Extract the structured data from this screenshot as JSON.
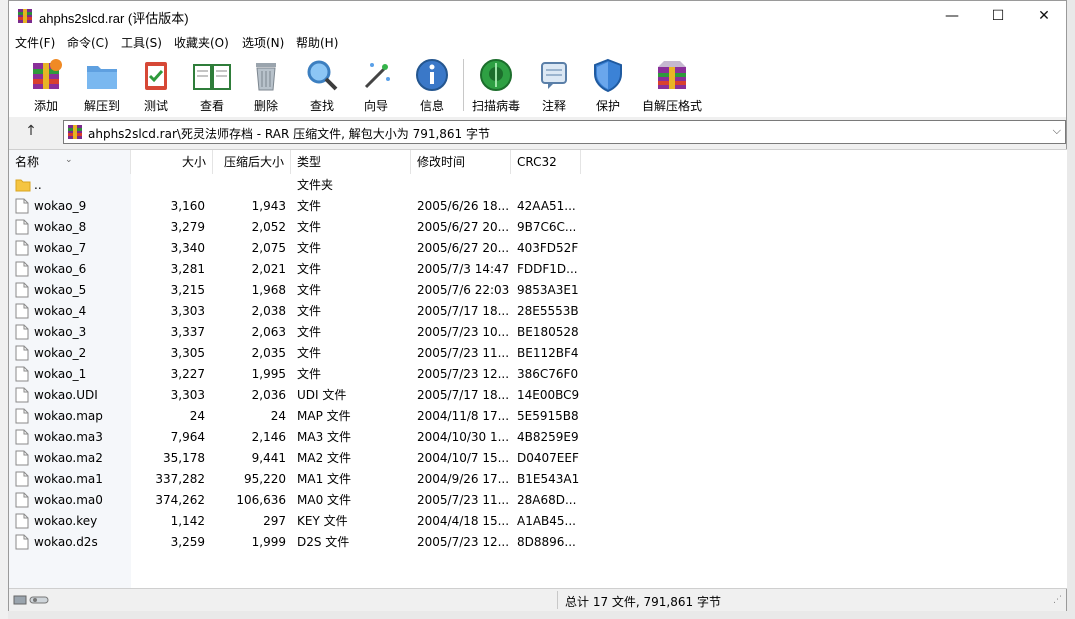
{
  "window": {
    "title": "ahphs2slcd.rar (评估版本)",
    "minimize": "—",
    "maximize": "☐",
    "close": "✕"
  },
  "menu": [
    "文件(F)",
    "命令(C)",
    "工具(S)",
    "收藏夹(O)",
    "选项(N)",
    "帮助(H)"
  ],
  "toolbar": [
    {
      "label": "添加",
      "icon": "add-archive-icon"
    },
    {
      "label": "解压到",
      "icon": "extract-folder-icon"
    },
    {
      "label": "测试",
      "icon": "test-clipboard-icon"
    },
    {
      "label": "查看",
      "icon": "view-book-icon"
    },
    {
      "label": "删除",
      "icon": "trash-icon"
    },
    {
      "label": "查找",
      "icon": "magnifier-icon"
    },
    {
      "label": "向导",
      "icon": "wizard-wand-icon"
    },
    {
      "label": "信息",
      "icon": "info-icon"
    },
    {
      "label": "扫描病毒",
      "icon": "virus-scan-icon"
    },
    {
      "label": "注释",
      "icon": "comment-icon"
    },
    {
      "label": "保护",
      "icon": "shield-icon"
    },
    {
      "label": "自解压格式",
      "icon": "sfx-box-icon"
    }
  ],
  "address": {
    "up": "↑",
    "path": "ahphs2slcd.rar\\死灵法师存档 - RAR 压缩文件, 解包大小为 791,861 字节",
    "dropdown": "⌵"
  },
  "columns": {
    "name": "名称",
    "size": "大小",
    "packed": "压缩后大小",
    "type": "类型",
    "modified": "修改时间",
    "crc": "CRC32"
  },
  "files": [
    {
      "name": "..",
      "size": "",
      "packed": "",
      "type": "文件夹",
      "modified": "",
      "crc": "",
      "folder": true
    },
    {
      "name": "wokao_9",
      "size": "3,160",
      "packed": "1,943",
      "type": "文件",
      "modified": "2005/6/26 18...",
      "crc": "42AA51..."
    },
    {
      "name": "wokao_8",
      "size": "3,279",
      "packed": "2,052",
      "type": "文件",
      "modified": "2005/6/27 20...",
      "crc": "9B7C6C..."
    },
    {
      "name": "wokao_7",
      "size": "3,340",
      "packed": "2,075",
      "type": "文件",
      "modified": "2005/6/27 20...",
      "crc": "403FD52F"
    },
    {
      "name": "wokao_6",
      "size": "3,281",
      "packed": "2,021",
      "type": "文件",
      "modified": "2005/7/3 14:47",
      "crc": "FDDF1D..."
    },
    {
      "name": "wokao_5",
      "size": "3,215",
      "packed": "1,968",
      "type": "文件",
      "modified": "2005/7/6 22:03",
      "crc": "9853A3E1"
    },
    {
      "name": "wokao_4",
      "size": "3,303",
      "packed": "2,038",
      "type": "文件",
      "modified": "2005/7/17 18...",
      "crc": "28E5553B"
    },
    {
      "name": "wokao_3",
      "size": "3,337",
      "packed": "2,063",
      "type": "文件",
      "modified": "2005/7/23 10...",
      "crc": "BE180528"
    },
    {
      "name": "wokao_2",
      "size": "3,305",
      "packed": "2,035",
      "type": "文件",
      "modified": "2005/7/23 11...",
      "crc": "BE112BF4"
    },
    {
      "name": "wokao_1",
      "size": "3,227",
      "packed": "1,995",
      "type": "文件",
      "modified": "2005/7/23 12...",
      "crc": "386C76F0"
    },
    {
      "name": "wokao.UDI",
      "size": "3,303",
      "packed": "2,036",
      "type": "UDI 文件",
      "modified": "2005/7/17 18...",
      "crc": "14E00BC9"
    },
    {
      "name": "wokao.map",
      "size": "24",
      "packed": "24",
      "type": "MAP 文件",
      "modified": "2004/11/8 17...",
      "crc": "5E5915B8"
    },
    {
      "name": "wokao.ma3",
      "size": "7,964",
      "packed": "2,146",
      "type": "MA3 文件",
      "modified": "2004/10/30 1...",
      "crc": "4B8259E9"
    },
    {
      "name": "wokao.ma2",
      "size": "35,178",
      "packed": "9,441",
      "type": "MA2 文件",
      "modified": "2004/10/7 15...",
      "crc": "D0407EEF"
    },
    {
      "name": "wokao.ma1",
      "size": "337,282",
      "packed": "95,220",
      "type": "MA1 文件",
      "modified": "2004/9/26 17...",
      "crc": "B1E543A1"
    },
    {
      "name": "wokao.ma0",
      "size": "374,262",
      "packed": "106,636",
      "type": "MA0 文件",
      "modified": "2005/7/23 11...",
      "crc": "28A68D..."
    },
    {
      "name": "wokao.key",
      "size": "1,142",
      "packed": "297",
      "type": "KEY 文件",
      "modified": "2004/4/18 15...",
      "crc": "A1AB45..."
    },
    {
      "name": "wokao.d2s",
      "size": "3,259",
      "packed": "1,999",
      "type": "D2S 文件",
      "modified": "2005/7/23 12...",
      "crc": "8D8896..."
    }
  ],
  "status": {
    "summary": "总计 17 文件, 791,861 字节"
  },
  "colors": {
    "folder": "#f5c542",
    "accent": "#0a64b4"
  }
}
